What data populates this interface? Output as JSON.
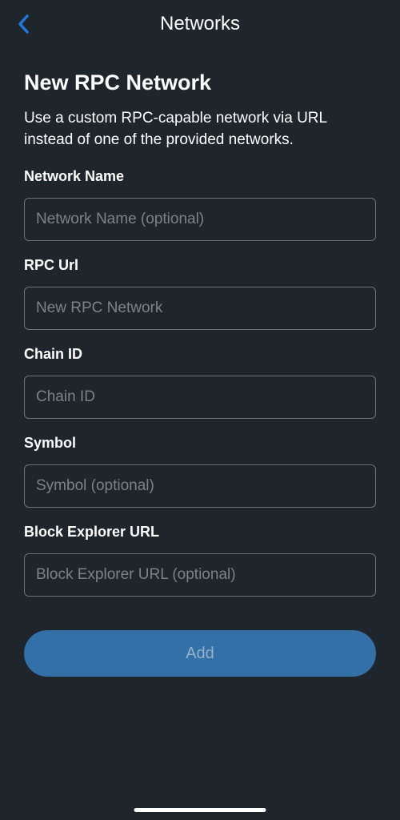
{
  "header": {
    "title": "Networks"
  },
  "page": {
    "title": "New RPC Network",
    "description": "Use a custom RPC-capable network via URL instead of one of the provided networks."
  },
  "form": {
    "networkName": {
      "label": "Network Name",
      "placeholder": "Network Name (optional)",
      "value": ""
    },
    "rpcUrl": {
      "label": "RPC Url",
      "placeholder": "New RPC Network",
      "value": ""
    },
    "chainId": {
      "label": "Chain ID",
      "placeholder": "Chain ID",
      "value": ""
    },
    "symbol": {
      "label": "Symbol",
      "placeholder": "Symbol (optional)",
      "value": ""
    },
    "blockExplorer": {
      "label": "Block Explorer URL",
      "placeholder": "Block Explorer URL (optional)",
      "value": ""
    },
    "submitLabel": "Add"
  }
}
